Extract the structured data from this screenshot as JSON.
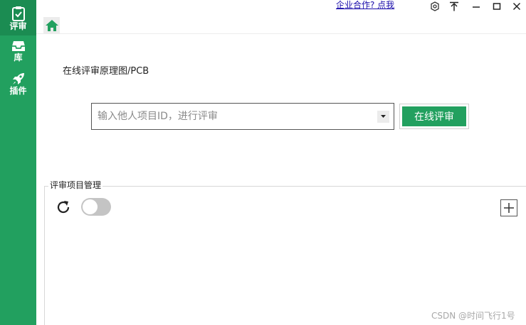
{
  "sidebar": {
    "items": [
      {
        "label": "评审",
        "icon": "clipboard-check-icon",
        "active": true
      },
      {
        "label": "库",
        "icon": "inbox-icon",
        "active": false
      },
      {
        "label": "插件",
        "icon": "rocket-icon",
        "active": false
      }
    ]
  },
  "topbar": {
    "coop_link": "企业合作? 点我",
    "home_icon": "home-icon",
    "controls": [
      "settings-icon",
      "pin-top-icon",
      "minimize-icon",
      "maximize-icon",
      "close-icon"
    ]
  },
  "main": {
    "title": "在线评审原理图/PCB",
    "search_placeholder": "输入他人项目ID，进行评审",
    "review_button": "在线评审"
  },
  "project_panel": {
    "legend": "评审项目管理",
    "toggle_on": false
  },
  "watermark": "CSDN @时间飞行1号",
  "colors": {
    "accent": "#22a05f",
    "sidebar_active": "#1b8c52"
  }
}
